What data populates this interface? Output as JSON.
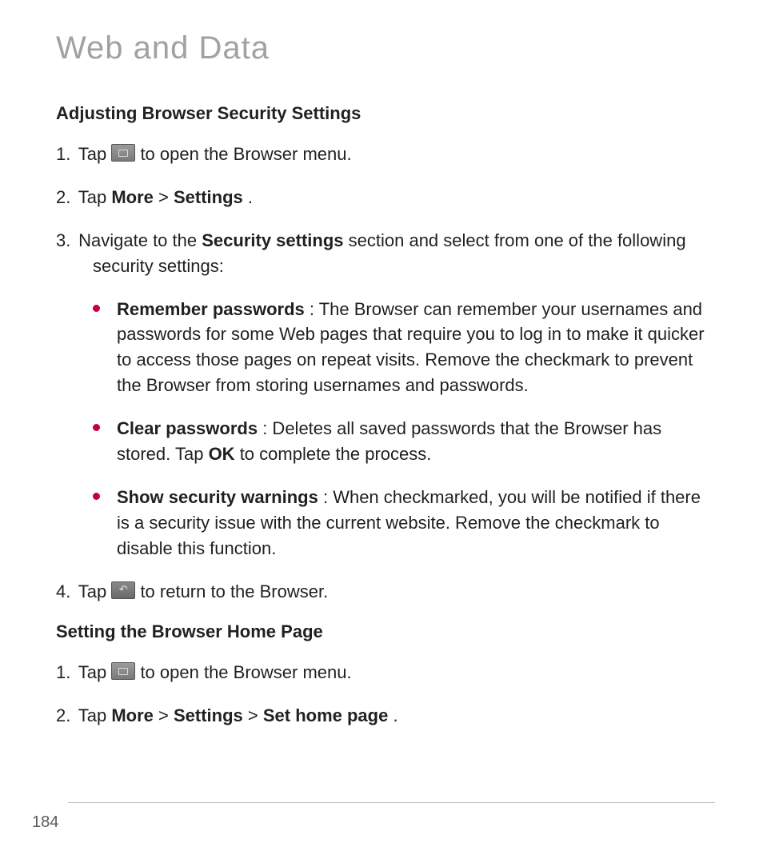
{
  "pageTitle": "Web and Data",
  "sectionA": {
    "heading": "Adjusting Browser Security Settings",
    "steps": [
      {
        "num": "1.",
        "pre": "Tap ",
        "icon": "menu",
        "post": " to open the Browser menu."
      },
      {
        "num": "2.",
        "pre": "Tap ",
        "b1": "More",
        "sep": " > ",
        "b2": "Settings",
        "after": "."
      },
      {
        "num": "3.",
        "pre": "Navigate to the ",
        "b1": "Security settings",
        "after": " section and select from one of the following security settings:"
      }
    ],
    "bullets": [
      {
        "title": "Remember passwords",
        "body": ": The Browser can remember your usernames and passwords for some Web pages that require you to log in to make it quicker to access those pages on repeat visits. Remove the checkmark to prevent the Browser from storing usernames and passwords."
      },
      {
        "title": "Clear passwords",
        "body": ": Deletes all saved passwords that the Browser has stored. Tap ",
        "b1": "OK",
        "tail": " to complete the process."
      },
      {
        "title": "Show security warnings",
        "body": ": When checkmarked, you will be notified if there is a security issue with the current website. Remove the checkmark to disable this function."
      }
    ],
    "step4": {
      "num": "4.",
      "pre": "Tap ",
      "icon": "back",
      "post": " to return to the Browser."
    }
  },
  "sectionB": {
    "heading": "Setting the Browser Home Page",
    "steps": [
      {
        "num": "1.",
        "pre": "Tap ",
        "icon": "menu",
        "post": " to open the Browser menu."
      },
      {
        "num": "2.",
        "pre": "Tap ",
        "b1": "More",
        "sep1": "  > ",
        "b2": "Settings",
        "sep2": " > ",
        "b3": "Set home page",
        "after": "."
      }
    ]
  },
  "pageNumber": "184"
}
